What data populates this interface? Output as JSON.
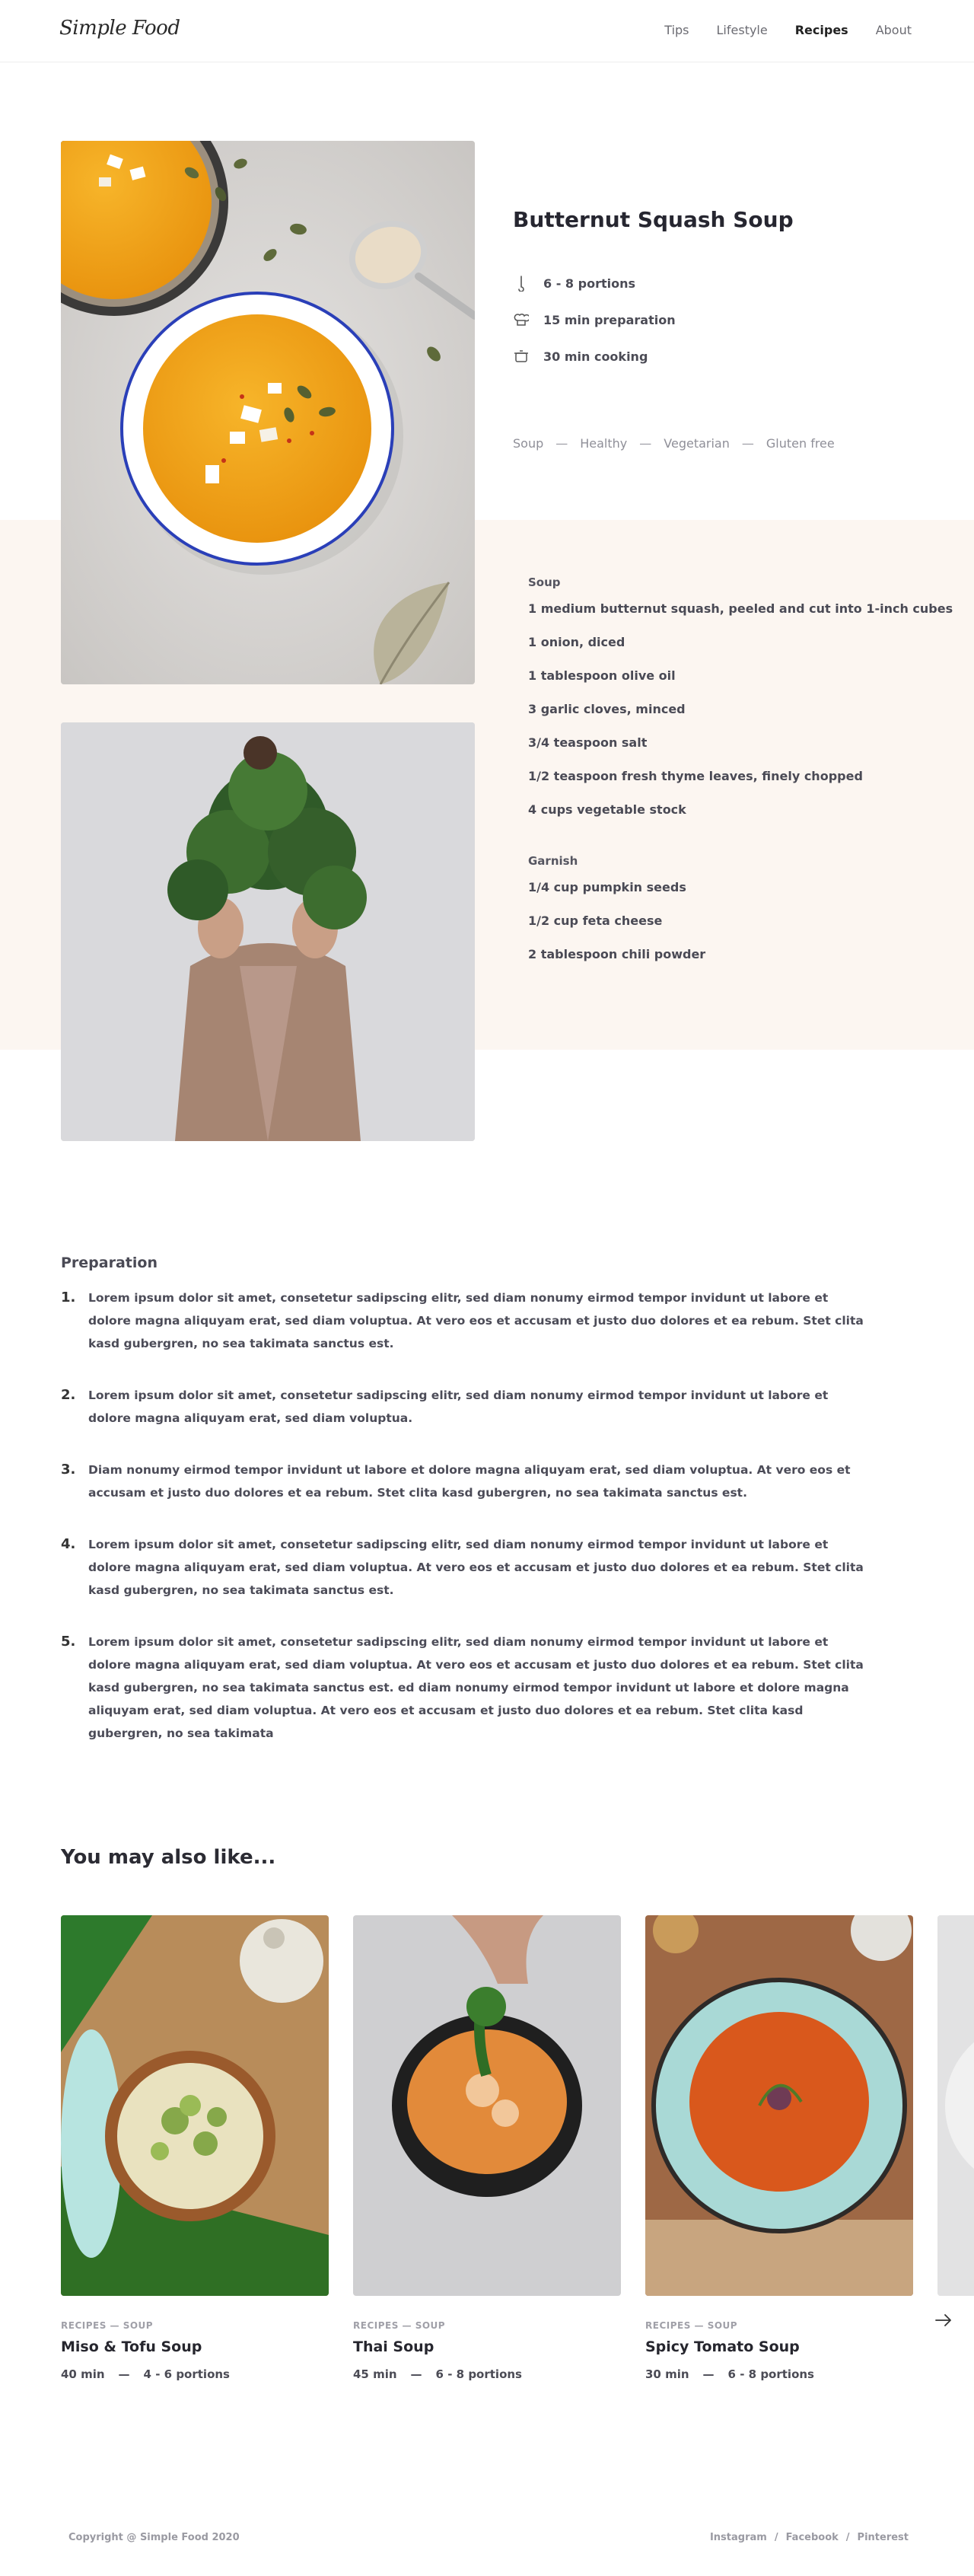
{
  "header": {
    "logo": "Simple Food",
    "nav": [
      "Tips",
      "Lifestyle",
      "Recipes",
      "About"
    ]
  },
  "recipe": {
    "title": "Butternut Squash Soup",
    "meta": {
      "portions": "6 - 8 portions",
      "preparation": "15 min preparation",
      "cooking": "30 min cooking"
    },
    "tags": [
      "Soup",
      "Healthy",
      "Vegetarian",
      "Gluten free"
    ],
    "ingredients": {
      "soup_heading": "Soup",
      "soup": [
        "1 medium butternut squash, peeled and cut into 1-inch cubes",
        "1 onion, diced",
        "1 tablespoon olive oil",
        "3 garlic cloves, minced",
        "3/4 teaspoon salt",
        "1/2 teaspoon fresh thyme leaves, finely chopped",
        "4 cups vegetable stock"
      ],
      "garnish_heading": "Garnish",
      "garnish": [
        "1/4 cup pumpkin seeds",
        "1/2 cup feta cheese",
        "2 tablespoon chili powder"
      ]
    }
  },
  "preparation": {
    "title": "Preparation",
    "steps": [
      {
        "num": "1.",
        "text": "Lorem ipsum dolor sit amet, consetetur sadipscing elitr, sed diam nonumy eirmod tempor invidunt ut labore et dolore magna aliquyam erat, sed diam voluptua. At vero eos et accusam et justo duo dolores et ea rebum. Stet clita kasd gubergren, no sea takimata sanctus est."
      },
      {
        "num": "2.",
        "text": "Lorem ipsum dolor sit amet, consetetur sadipscing elitr, sed diam nonumy eirmod tempor invidunt ut labore et dolore magna aliquyam erat, sed diam voluptua."
      },
      {
        "num": "3.",
        "text": "Diam nonumy eirmod tempor invidunt ut labore et dolore magna aliquyam erat, sed diam voluptua. At vero eos et accusam et justo duo dolores et ea rebum. Stet clita kasd gubergren, no sea takimata sanctus est."
      },
      {
        "num": "4.",
        "text": "Lorem ipsum dolor sit amet, consetetur sadipscing elitr, sed diam nonumy eirmod tempor invidunt ut labore et dolore magna aliquyam erat, sed diam voluptua. At vero eos et accusam et justo duo dolores et ea rebum. Stet clita kasd gubergren, no sea takimata sanctus est."
      },
      {
        "num": "5.",
        "text": "Lorem ipsum dolor sit amet, consetetur sadipscing elitr, sed diam nonumy eirmod tempor invidunt ut labore et dolore magna aliquyam erat, sed diam voluptua. At vero eos et accusam et justo duo dolores et ea rebum. Stet clita kasd gubergren, no sea takimata sanctus est. ed diam nonumy eirmod tempor invidunt ut labore et dolore magna aliquyam erat, sed diam voluptua. At vero eos et accusam et justo duo dolores et ea rebum. Stet clita kasd gubergren, no sea takimata"
      }
    ]
  },
  "related": {
    "title": "You may also like...",
    "cards": [
      {
        "category": "RECIPES — SOUP",
        "name": "Miso & Tofu Soup",
        "time": "40 min",
        "sep": "—",
        "portions": "4 - 6 portions"
      },
      {
        "category": "RECIPES — SOUP",
        "name": "Thai Soup",
        "time": "45 min",
        "sep": "—",
        "portions": "6 - 8 portions"
      },
      {
        "category": "RECIPES — SOUP",
        "name": "Spicy Tomato Soup",
        "time": "30 min",
        "sep": "—",
        "portions": "6 - 8 portions"
      }
    ],
    "next_icon": "arrow-right-icon"
  },
  "footer": {
    "copyright": "Copyright @ Simple Food 2020",
    "links": [
      "Instagram",
      "Facebook",
      "Pinterest"
    ],
    "separator": "/"
  }
}
